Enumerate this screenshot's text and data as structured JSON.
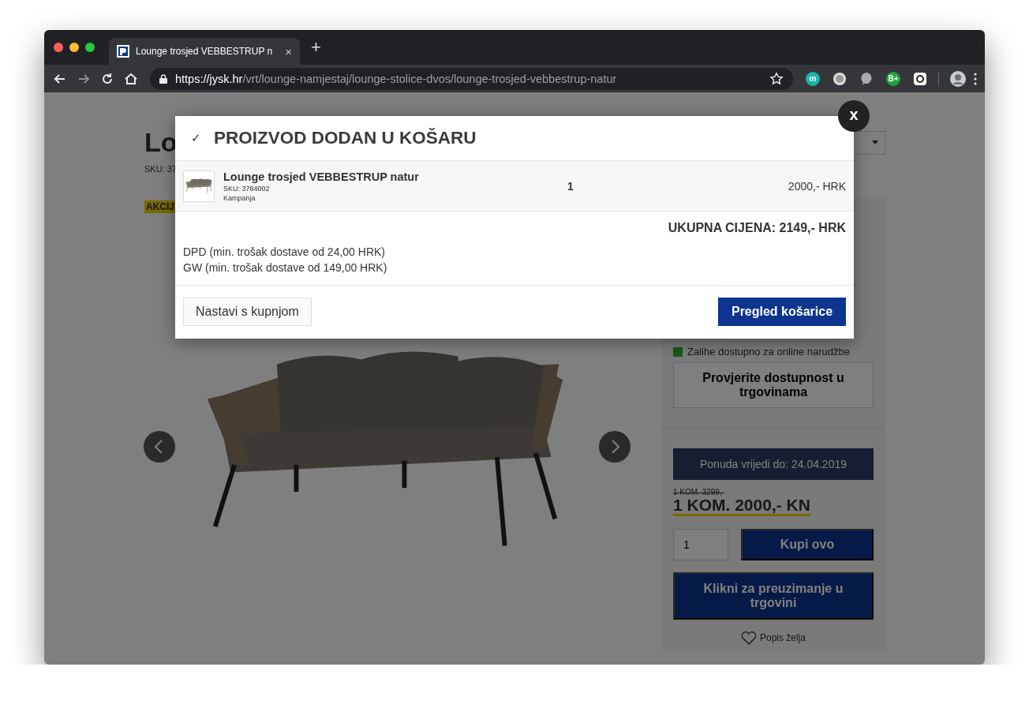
{
  "browser": {
    "tab_title": "Lounge trosjed VEBBESTRUP n",
    "tab_close": "×",
    "new_tab": "+",
    "url_host": "https://jysk.hr",
    "url_path": "/vrt/lounge-namjestaj/lounge-stolice-dvos/lounge-trosjed-vebbestrup-natur",
    "extensions": [
      {
        "kind": "letter",
        "label": "m"
      },
      {
        "kind": "disc"
      },
      {
        "kind": "bubble"
      },
      {
        "kind": "letter",
        "label": "B+"
      },
      {
        "kind": "square"
      }
    ]
  },
  "page": {
    "title": "Lo",
    "sku": "SKU: 37",
    "badge": "AKCIJ",
    "stock": "Zalihe dostupno za online narudžbe",
    "stock_button": "Provjerite dostupnost u trgovinama",
    "offer": "Ponuda vrijedi do: 24.04.2019",
    "old_price": "1 KOM. 3299,-",
    "price": "1 KOM. 2000,- KN",
    "quantity": "1",
    "buy_button": "Kupi ovo",
    "pickup_button": "Klikni za preuzimanje u trgovini",
    "wishlist": "Popis želja"
  },
  "modal": {
    "close": "x",
    "check": "✓",
    "title": "PROIZVOD DODAN U KOŠARU",
    "item": {
      "name": "Lounge trosjed VEBBESTRUP natur",
      "sku": "SKU: 3784002",
      "note": "Kampanja",
      "quantity": "1",
      "price": "2000,- HRK"
    },
    "total": "UKUPNA CIJENA: 2149,- HRK",
    "delivery": [
      "DPD (min. trošak dostave od 24,00 HRK)",
      "GW (min. trošak dostave od 149,00 HRK)"
    ],
    "continue_button": "Nastavi s kupnjom",
    "cart_button": "Pregled košarice"
  }
}
